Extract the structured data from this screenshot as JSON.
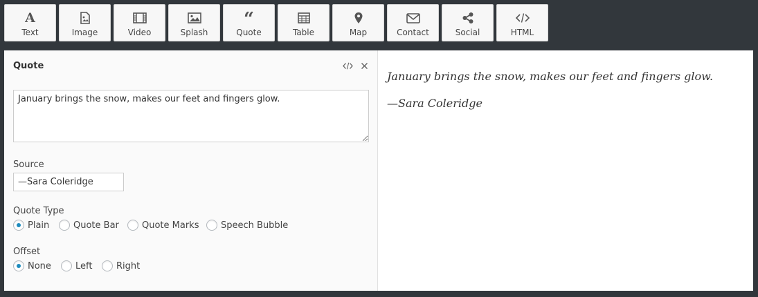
{
  "toolbar": {
    "items": [
      {
        "label": "Text",
        "icon": "text-icon"
      },
      {
        "label": "Image",
        "icon": "image-icon"
      },
      {
        "label": "Video",
        "icon": "video-icon"
      },
      {
        "label": "Splash",
        "icon": "splash-icon"
      },
      {
        "label": "Quote",
        "icon": "quote-icon"
      },
      {
        "label": "Table",
        "icon": "table-icon"
      },
      {
        "label": "Map",
        "icon": "map-pin-icon"
      },
      {
        "label": "Contact",
        "icon": "envelope-icon"
      },
      {
        "label": "Social",
        "icon": "share-icon"
      },
      {
        "label": "HTML",
        "icon": "code-icon"
      }
    ]
  },
  "editor": {
    "title": "Quote",
    "quote_text": "January brings the snow, makes our feet and fingers glow.",
    "source_label": "Source",
    "source_value": "—Sara Coleridge",
    "quote_type_label": "Quote Type",
    "quote_type_options": [
      "Plain",
      "Quote Bar",
      "Quote Marks",
      "Speech Bubble"
    ],
    "quote_type_selected": "Plain",
    "offset_label": "Offset",
    "offset_options": [
      "None",
      "Left",
      "Right"
    ],
    "offset_selected": "None"
  },
  "preview": {
    "quote": "January brings the snow, makes our feet and fingers glow.",
    "source": "—Sara Coleridge"
  },
  "colors": {
    "background": "#32373c",
    "radio_accent": "#1e8cbe"
  }
}
